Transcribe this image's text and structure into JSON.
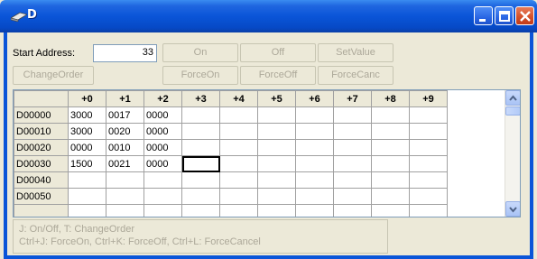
{
  "window": {
    "title": "D",
    "minimize_icon": "minimize-icon",
    "maximize_icon": "maximize-icon",
    "close_icon": "close-icon",
    "app_icon": "device-icon"
  },
  "toolbar": {
    "start_address_label": "Start Address:",
    "start_address_value": "33",
    "on_label": "On",
    "off_label": "Off",
    "setvalue_label": "SetValue",
    "changeorder_label": "ChangeOrder",
    "forceon_label": "ForceOn",
    "forceoff_label": "ForceOff",
    "forcecanc_label": "ForceCanc"
  },
  "grid": {
    "columns": [
      "+0",
      "+1",
      "+2",
      "+3",
      "+4",
      "+5",
      "+6",
      "+7",
      "+8",
      "+9"
    ],
    "rows": [
      {
        "label": "D00000",
        "cells": [
          "3000",
          "0017",
          "0000",
          "",
          "",
          "",
          "",
          "",
          "",
          ""
        ]
      },
      {
        "label": "D00010",
        "cells": [
          "3000",
          "0020",
          "0000",
          "",
          "",
          "",
          "",
          "",
          "",
          ""
        ]
      },
      {
        "label": "D00020",
        "cells": [
          "0000",
          "0010",
          "0000",
          "",
          "",
          "",
          "",
          "",
          "",
          ""
        ]
      },
      {
        "label": "D00030",
        "cells": [
          "1500",
          "0021",
          "0000",
          "",
          "",
          "",
          "",
          "",
          "",
          ""
        ]
      },
      {
        "label": "D00040",
        "cells": [
          "",
          "",
          "",
          "",
          "",
          "",
          "",
          "",
          "",
          ""
        ]
      },
      {
        "label": "D00050",
        "cells": [
          "",
          "",
          "",
          "",
          "",
          "",
          "",
          "",
          "",
          ""
        ]
      },
      {
        "label": "",
        "cells": [
          "",
          "",
          "",
          "",
          "",
          "",
          "",
          "",
          "",
          ""
        ]
      }
    ],
    "selected_row": 3,
    "selected_col": 3
  },
  "hint": {
    "line1": "J: On/Off,   T: ChangeOrder",
    "line2": "Ctrl+J: ForceOn,   Ctrl+K: ForceOff,   Ctrl+L: ForceCancel"
  }
}
